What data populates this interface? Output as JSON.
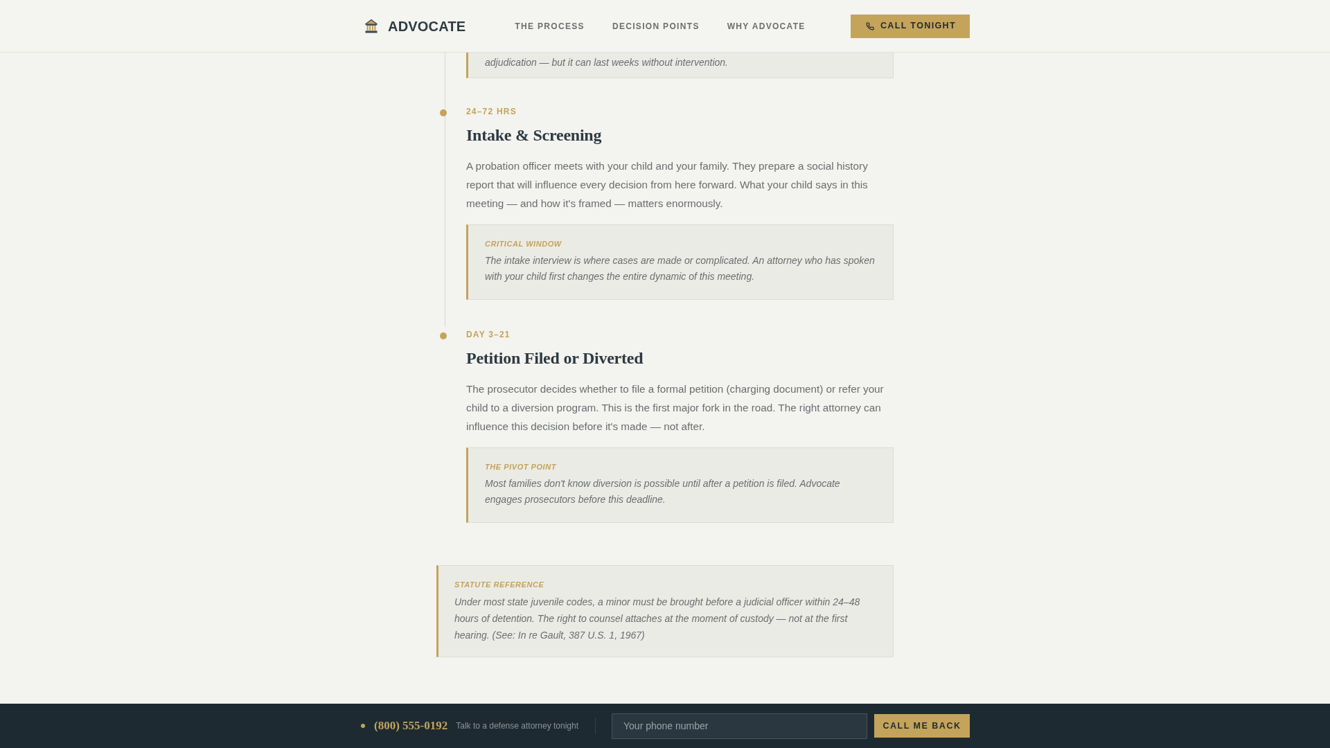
{
  "header": {
    "logo": "ADVOCATE",
    "nav": [
      {
        "label": "THE PROCESS"
      },
      {
        "label": "DECISION POINTS"
      },
      {
        "label": "WHY ADVOCATE"
      }
    ],
    "cta": "CALL TONIGHT"
  },
  "timeline": [
    {
      "callout": {
        "text": "adjudication — but it can last weeks without intervention."
      }
    },
    {
      "time": "24–72 HRS",
      "title": "Intake & Screening",
      "body": "A probation officer meets with your child and your family. They prepare a social history report that will influence every decision from here forward. What your child says in this meeting — and how it's framed — matters enormously.",
      "callout": {
        "label": "CRITICAL WINDOW",
        "text": "The intake interview is where cases are made or complicated. An attorney who has spoken with your child first changes the entire dynamic of this meeting."
      }
    },
    {
      "time": "DAY 3–21",
      "title": "Petition Filed or Diverted",
      "body": "The prosecutor decides whether to file a formal petition (charging document) or refer your child to a diversion program. This is the first major fork in the road. The right attorney can influence this decision before it's made — not after.",
      "callout": {
        "label": "THE PIVOT POINT",
        "text": "Most families don't know diversion is possible until after a petition is filed. Advocate engages prosecutors before this deadline."
      }
    }
  ],
  "statute": {
    "label": "STATUTE REFERENCE",
    "text": "Under most state juvenile codes, a minor must be brought before a judicial officer within 24–48 hours of detention. The right to counsel attaches at the moment of custody — not at the first hearing. (See: In re Gault, 387 U.S. 1, 1967)"
  },
  "footer": {
    "phone": "(800) 555-0192",
    "tagline": "Talk to a defense attorney tonight",
    "input": {
      "placeholder": "Your phone number"
    },
    "button": "CALL ME BACK"
  }
}
